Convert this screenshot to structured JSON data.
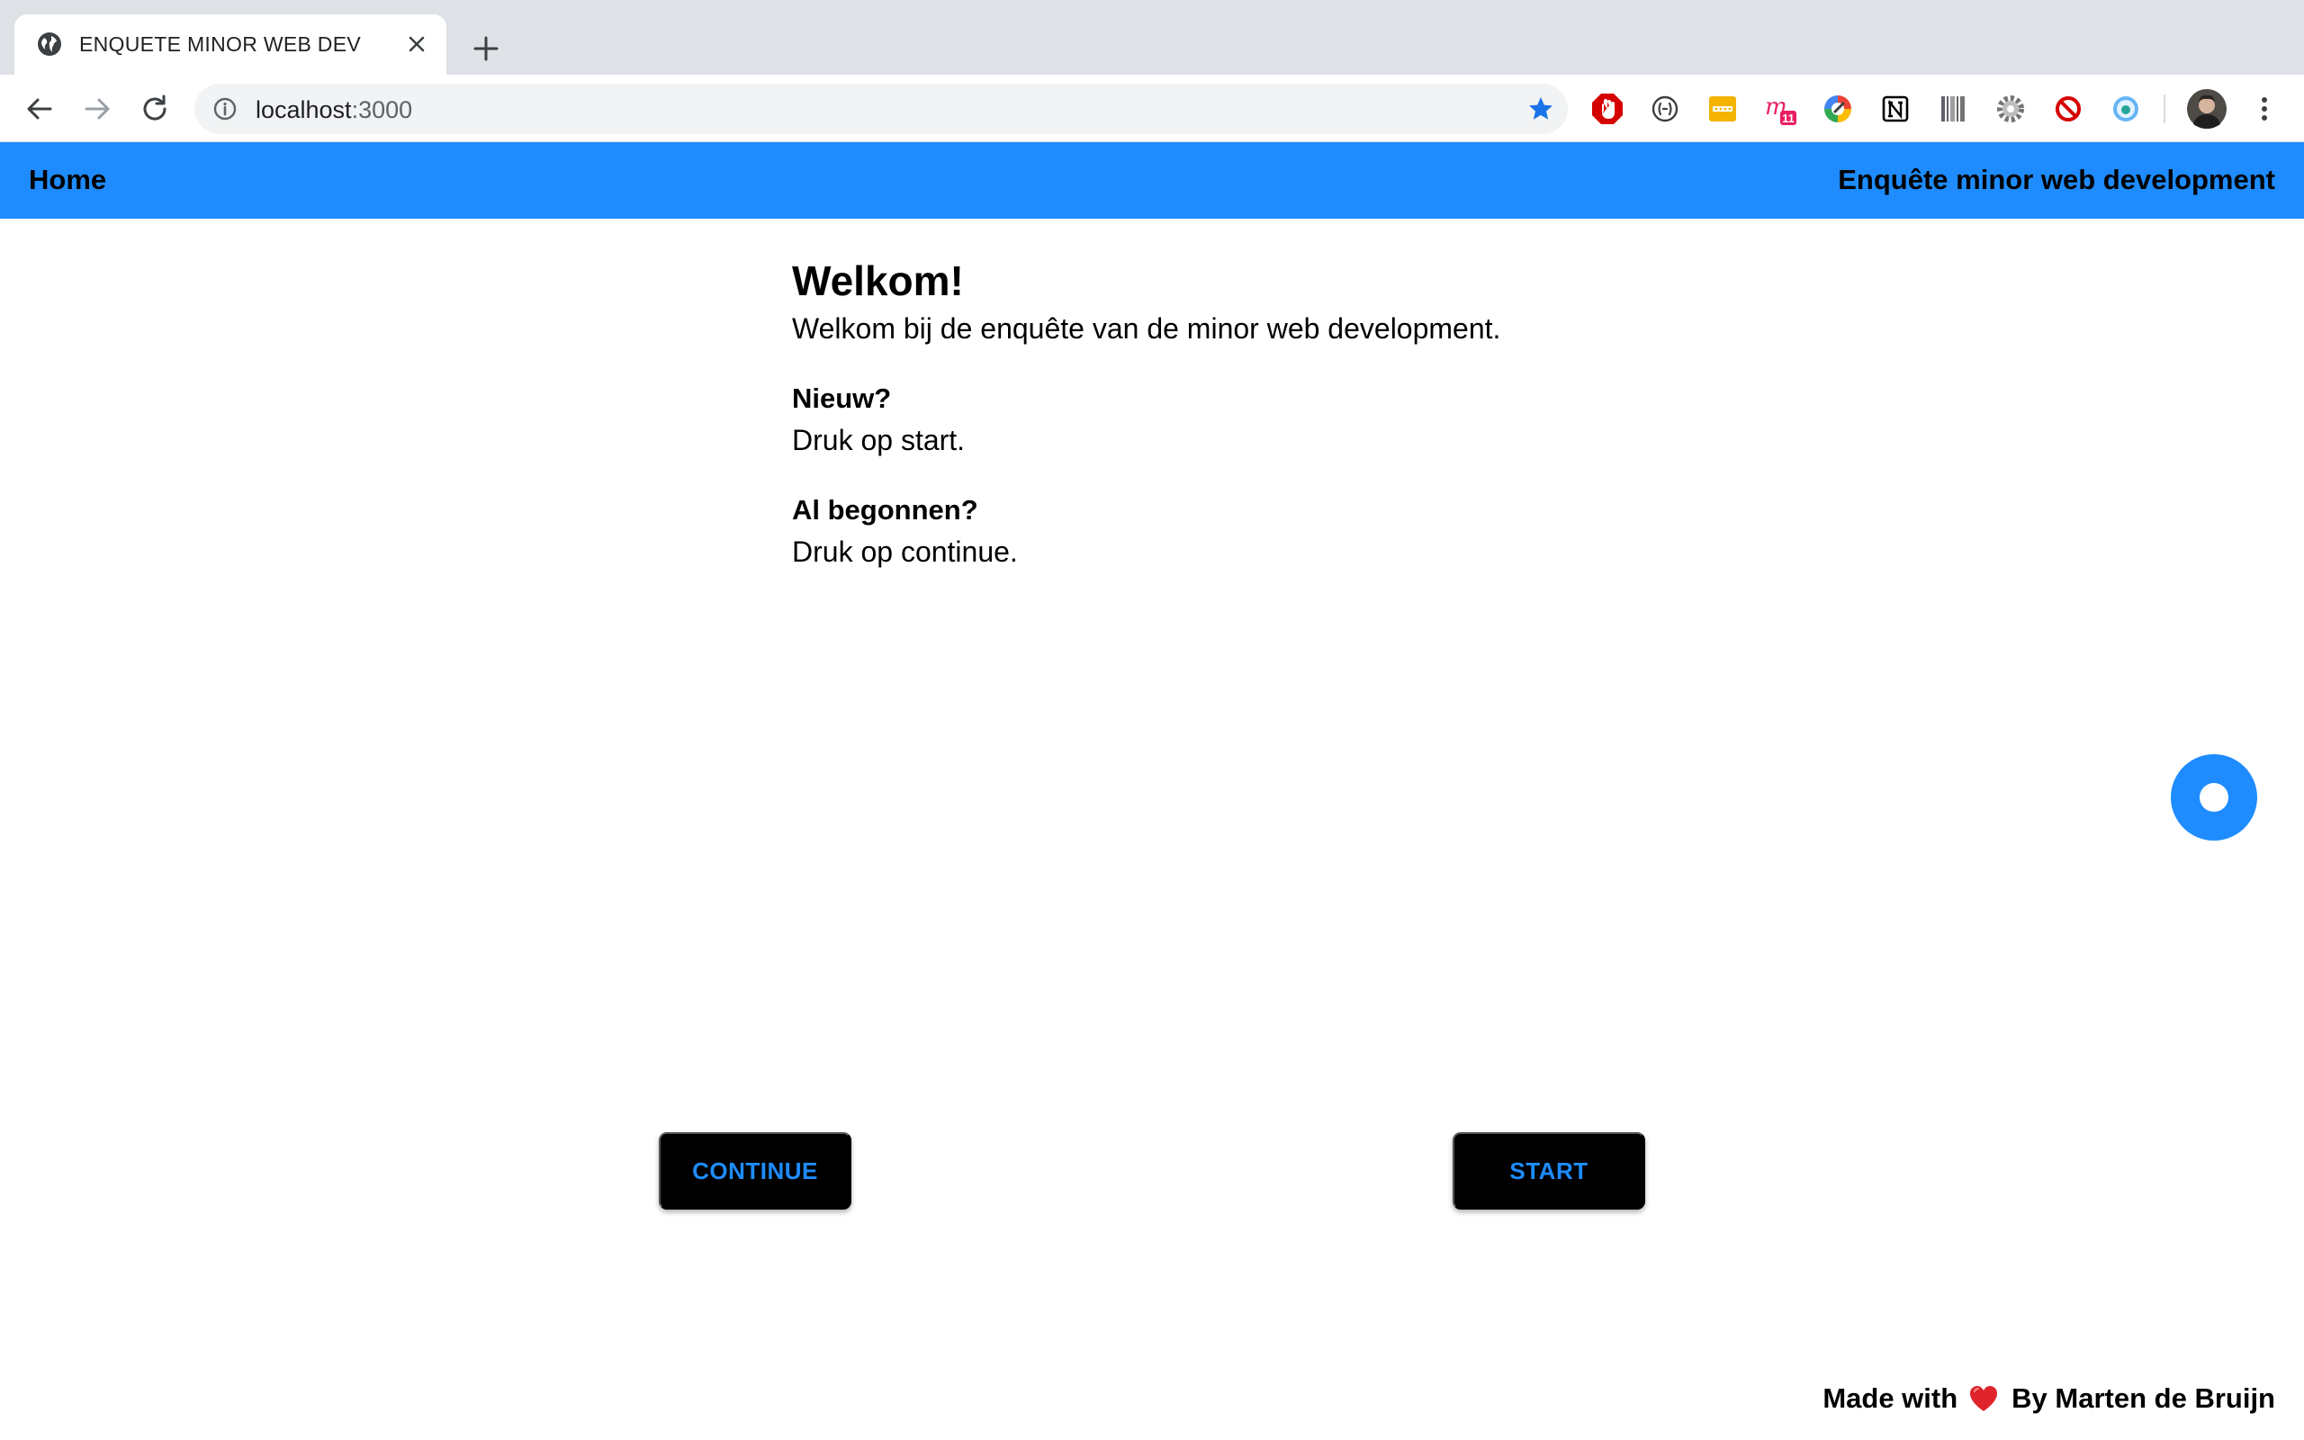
{
  "browser": {
    "tab_title": "ENQUETE MINOR WEB DEV",
    "url_host": "localhost",
    "url_port": ":3000",
    "icons": [
      "globe-icon",
      "close-icon",
      "plus-icon",
      "back-arrow-icon",
      "forward-arrow-icon",
      "reload-icon",
      "info-icon",
      "star-icon",
      "more-vert-icon",
      "avatar"
    ],
    "extensions": [
      "adblock-icon",
      "code-brackets-icon",
      "password-icon",
      "mail-badge-icon",
      "color-circle-icon",
      "notion-icon",
      "barcode-icon",
      "gear-icon",
      "block-icon",
      "eye-circle-icon"
    ],
    "ext_badge": "11",
    "colors": {
      "star": "#1a73e8",
      "tabstrip": "#dee1e6"
    }
  },
  "header": {
    "home_label": "Home",
    "brand": "Enquête minor web development",
    "color": "#1e8cff"
  },
  "main": {
    "title": "Welkom!",
    "intro": "Welkom bij de enquête van de minor web development.",
    "new_title": "Nieuw?",
    "new_text": "Druk op start.",
    "resume_title": "Al begonnen?",
    "resume_text": "Druk op continue."
  },
  "buttons": {
    "continue_label": "CONTINUE",
    "start_label": "START"
  },
  "footer": {
    "made_with": "Made with",
    "author": "By Marten de Bruijn"
  }
}
